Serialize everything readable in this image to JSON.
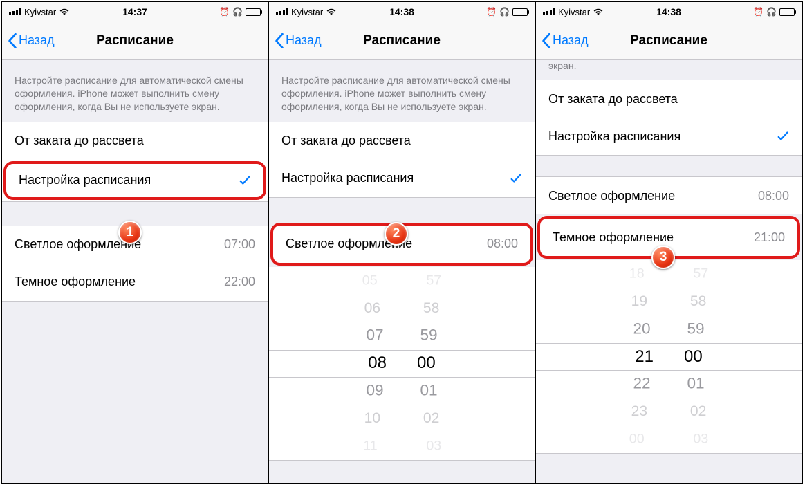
{
  "statusBar": {
    "carrier": "Kyivstar",
    "panels": [
      {
        "time": "14:37"
      },
      {
        "time": "14:38"
      },
      {
        "time": "14:38"
      }
    ]
  },
  "nav": {
    "back": "Назад",
    "title": "Расписание"
  },
  "sectionText": "Настройте расписание для автоматической смены оформления. iPhone может выполнить смену оформления, когда Вы не используете экран.",
  "partialSectionText": "экран.",
  "options": {
    "sunset": "От заката до рассвета",
    "custom": "Настройка расписания"
  },
  "appearance": {
    "light": "Светлое оформление",
    "dark": "Темное оформление"
  },
  "times": {
    "p1_light": "07:00",
    "p1_dark": "22:00",
    "p2_light": "08:00",
    "p3_light": "08:00",
    "p3_dark": "21:00"
  },
  "badges": {
    "b1": "1",
    "b2": "2",
    "b3": "3"
  },
  "picker2": {
    "hours": [
      "05",
      "06",
      "07",
      "08",
      "09",
      "10",
      "11"
    ],
    "minutes": [
      "57",
      "58",
      "59",
      "00",
      "01",
      "02",
      "03"
    ]
  },
  "picker3": {
    "hours": [
      "18",
      "19",
      "20",
      "21",
      "22",
      "23",
      "00"
    ],
    "minutes": [
      "57",
      "58",
      "59",
      "00",
      "01",
      "02",
      "03"
    ]
  }
}
